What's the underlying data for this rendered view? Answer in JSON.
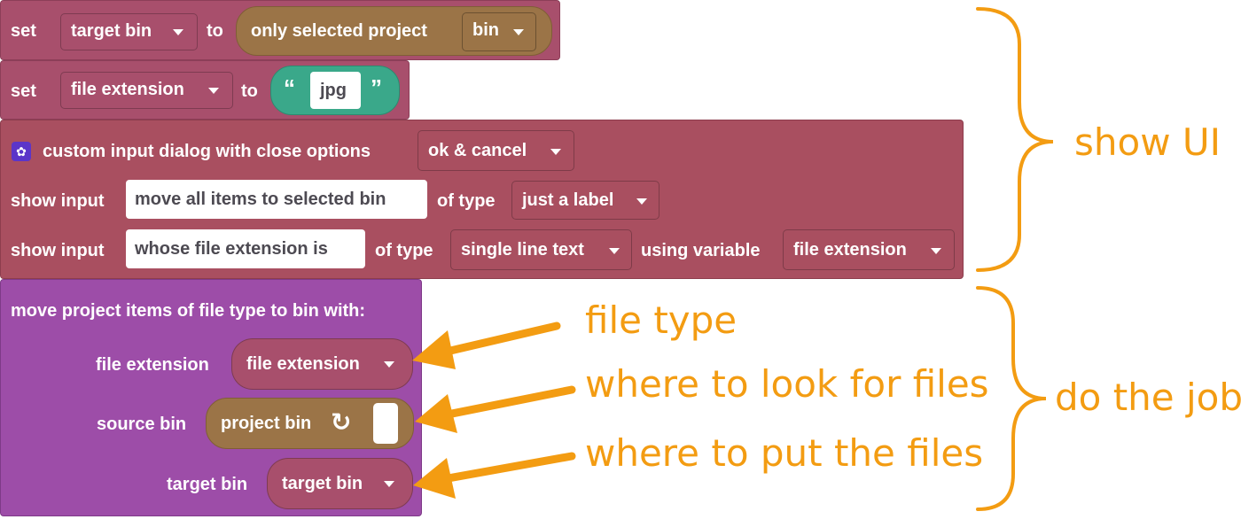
{
  "block1": {
    "set_label": "set",
    "variable": "target bin",
    "to_label": "to",
    "reporter_label": "only selected  project",
    "reporter_dropdown": "bin"
  },
  "block2": {
    "set_label": "set",
    "variable": "file extension",
    "to_label": "to",
    "open_quote": "“",
    "text_value": "jpg",
    "close_quote": "”"
  },
  "dialog_block": {
    "title": "custom input dialog with close options",
    "close_options": "ok & cancel",
    "row1": {
      "show_input_label": "show input",
      "text": "move all items to selected bin",
      "of_type_label": "of type",
      "type": "just a label"
    },
    "row2": {
      "show_input_label": "show input",
      "text": "whose file extension is",
      "of_type_label": "of type",
      "type": "single line text",
      "using_variable_label": "using variable",
      "variable": "file extension"
    }
  },
  "move_block": {
    "title": "move project items of file type to bin  with:",
    "file_extension_label": "file extension",
    "file_extension_value": "file extension",
    "source_bin_label": "source bin",
    "source_bin_value": "project bin",
    "target_bin_label": "target bin",
    "target_bin_value": "target bin"
  },
  "annotations": {
    "show_ui": "show UI",
    "do_the_job": "do the job",
    "file_type": "file type",
    "where_to_look": "where to look for files",
    "where_to_put": "where to put the files"
  },
  "colors": {
    "variable_block": "#a84f6c",
    "dialog_block": "#a94f60",
    "move_block": "#9d4da8",
    "reporter_brown": "#9b7447",
    "text_teal": "#3aa88a",
    "annotation_orange": "#f39c12"
  }
}
